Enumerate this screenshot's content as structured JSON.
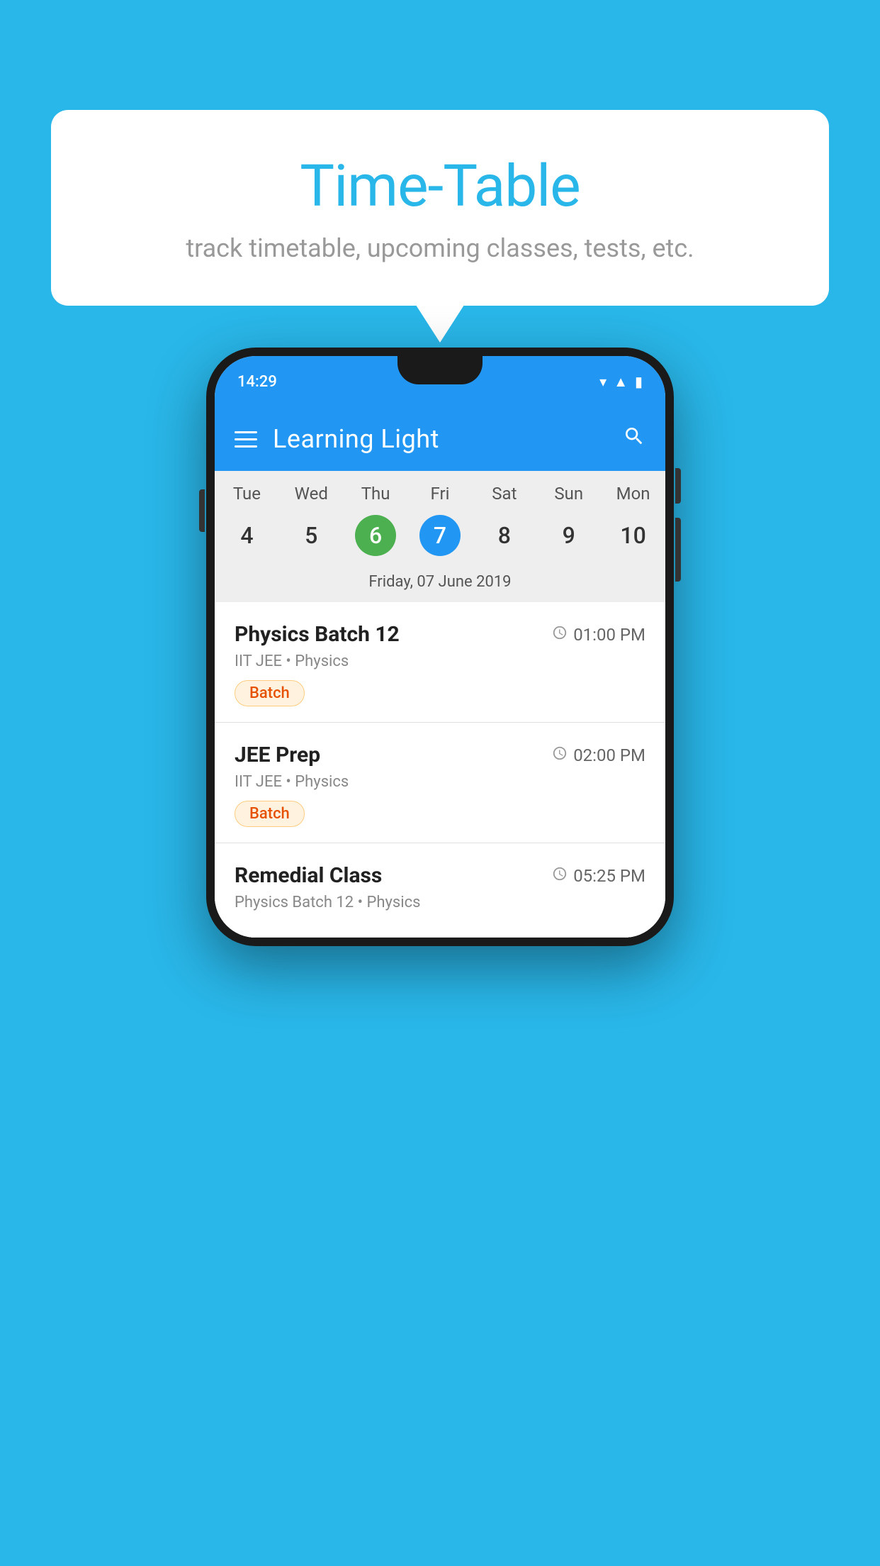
{
  "background_color": "#29B6E8",
  "speech_bubble": {
    "title": "Time-Table",
    "subtitle": "track timetable, upcoming classes, tests, etc."
  },
  "phone": {
    "status_bar": {
      "time": "14:29"
    },
    "header": {
      "app_name": "Learning Light"
    },
    "calendar": {
      "days": [
        "Tue",
        "Wed",
        "Thu",
        "Fri",
        "Sat",
        "Sun",
        "Mon"
      ],
      "dates": [
        {
          "number": "4",
          "state": "normal"
        },
        {
          "number": "5",
          "state": "normal"
        },
        {
          "number": "6",
          "state": "today"
        },
        {
          "number": "7",
          "state": "selected"
        },
        {
          "number": "8",
          "state": "normal"
        },
        {
          "number": "9",
          "state": "normal"
        },
        {
          "number": "10",
          "state": "normal"
        }
      ],
      "selected_date_label": "Friday, 07 June 2019"
    },
    "schedule": [
      {
        "title": "Physics Batch 12",
        "time": "01:00 PM",
        "meta": "IIT JEE • Physics",
        "tag": "Batch"
      },
      {
        "title": "JEE Prep",
        "time": "02:00 PM",
        "meta": "IIT JEE • Physics",
        "tag": "Batch"
      },
      {
        "title": "Remedial Class",
        "time": "05:25 PM",
        "meta": "Physics Batch 12 • Physics",
        "tag": null
      }
    ]
  },
  "icons": {
    "hamburger": "☰",
    "search": "🔍",
    "clock": "🕐"
  }
}
